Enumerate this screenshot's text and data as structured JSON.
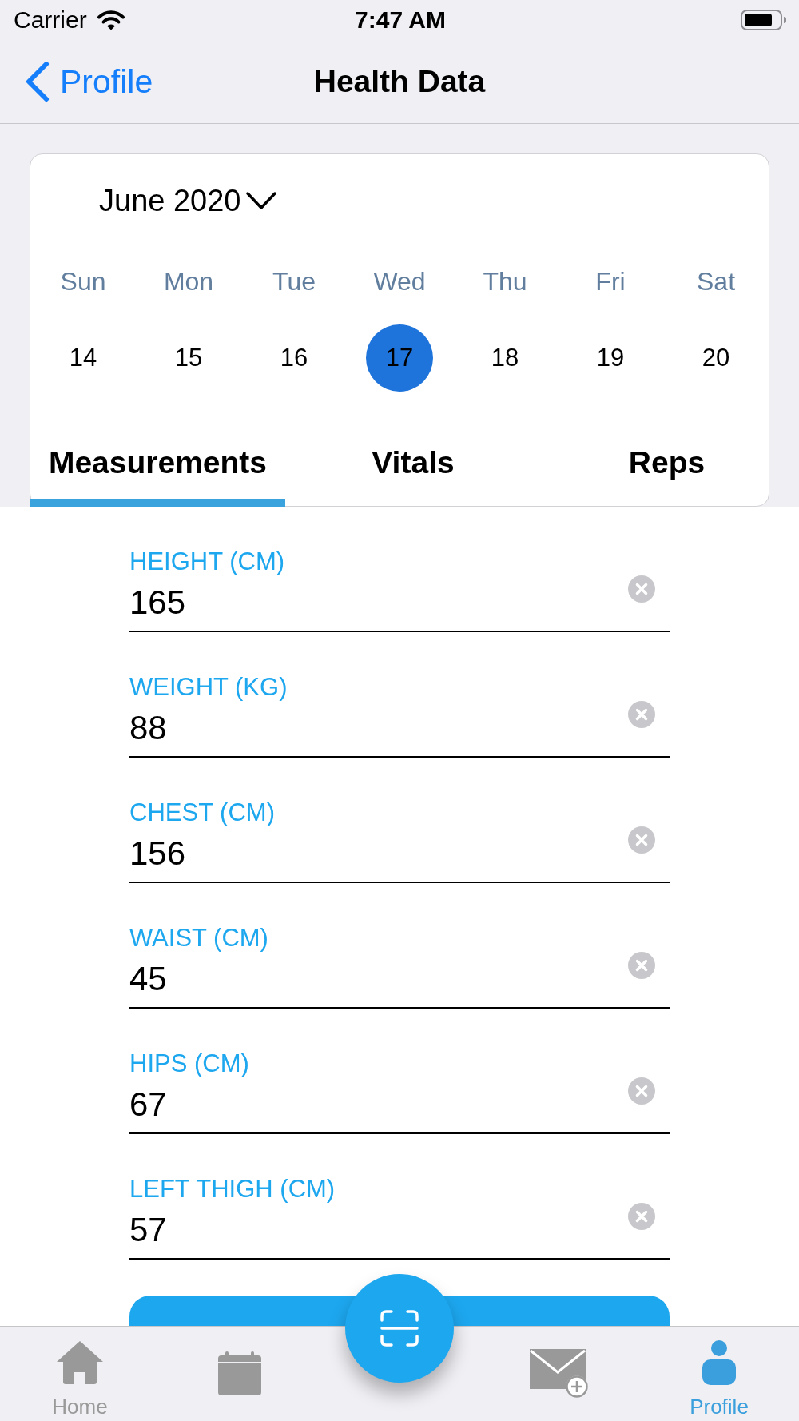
{
  "status_bar": {
    "carrier": "Carrier",
    "time": "7:47 AM"
  },
  "nav_bar": {
    "back_label": "Profile",
    "title": "Health Data"
  },
  "calendar": {
    "month": "June 2020",
    "days": [
      {
        "weekday": "Sun",
        "date": "14",
        "selected": false
      },
      {
        "weekday": "Mon",
        "date": "15",
        "selected": false
      },
      {
        "weekday": "Tue",
        "date": "16",
        "selected": false
      },
      {
        "weekday": "Wed",
        "date": "17",
        "selected": true
      },
      {
        "weekday": "Thu",
        "date": "18",
        "selected": false
      },
      {
        "weekday": "Fri",
        "date": "19",
        "selected": false
      },
      {
        "weekday": "Sat",
        "date": "20",
        "selected": false
      }
    ]
  },
  "tabs": [
    {
      "label": "Measurements",
      "selected": true
    },
    {
      "label": "Vitals",
      "selected": false
    },
    {
      "label": "Reps",
      "selected": false
    }
  ],
  "fields": [
    {
      "label": "HEIGHT (CM)",
      "value": "165"
    },
    {
      "label": "WEIGHT (KG)",
      "value": "88"
    },
    {
      "label": "CHEST (CM)",
      "value": "156"
    },
    {
      "label": "WAIST (CM)",
      "value": "45"
    },
    {
      "label": "HIPS (CM)",
      "value": "67"
    },
    {
      "label": "LEFT THIGH (CM)",
      "value": "57"
    }
  ],
  "tab_bar": {
    "items": [
      {
        "label": "Home",
        "selected": false
      },
      {
        "selected": false
      },
      {
        "selected": false
      },
      {
        "label": "Profile",
        "selected": true
      }
    ]
  }
}
